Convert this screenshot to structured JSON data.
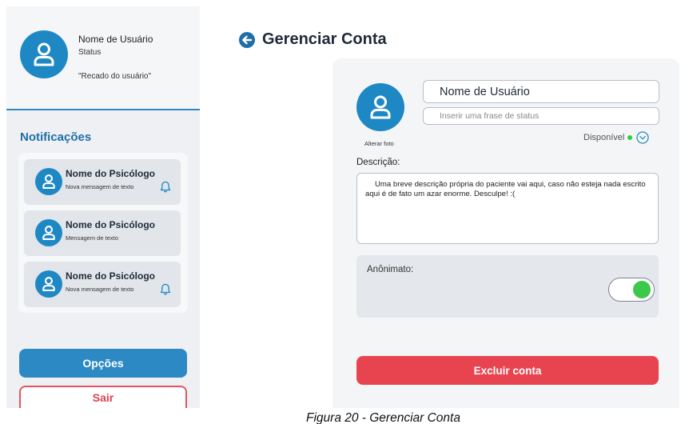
{
  "sidebar": {
    "profile": {
      "name": "Nome de Usuário",
      "status": "Status",
      "recado": "\"Recado do usuário\""
    },
    "notifications_title": "Notificações",
    "notifications": [
      {
        "name": "Nome do Psicólogo",
        "message": "Nova mensagem de texto",
        "has_bell": true
      },
      {
        "name": "Nome do Psicólogo",
        "message": "Mensagem de texto",
        "has_bell": false
      },
      {
        "name": "Nome do Psicólogo",
        "message": "Nova mensagem de texto",
        "has_bell": true
      }
    ],
    "options_label": "Opções",
    "logout_label": "Sair"
  },
  "header": {
    "title": "Gerenciar Conta",
    "back_icon": "arrow-left-circle-icon"
  },
  "account": {
    "avatar_icon": "user-icon",
    "change_photo_label": "Alterar foto",
    "username_value": "Nome de Usuário",
    "status_placeholder": "Inserir uma frase de status",
    "availability_label": "Disponível",
    "availability_color": "#2ecc40",
    "description_label": "Descrição:",
    "description_text": "Uma breve descrição própria do paciente vai aqui, caso não esteja nada escrito aqui é de fato um azar enorme. Desculpe! :(",
    "anonymity_label": "Anônimato:",
    "anonymity_enabled": true,
    "delete_label": "Excluir conta"
  },
  "caption": "Figura 20 - Gerenciar Conta",
  "colors": {
    "primary": "#2d89c4",
    "avatar": "#1e88c5",
    "danger": "#e8444f",
    "toggle_on": "#3cc84a"
  }
}
